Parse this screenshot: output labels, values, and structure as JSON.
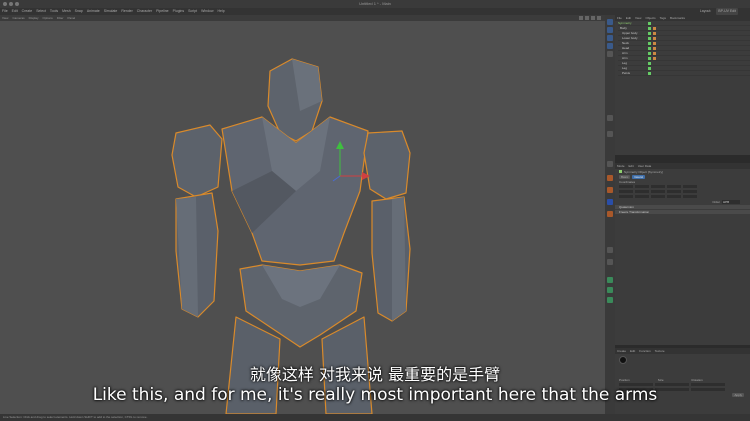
{
  "window": {
    "title": "Untitled 1 * - Main"
  },
  "menu": {
    "items": [
      "File",
      "Edit",
      "Create",
      "Select",
      "Tools",
      "Mesh",
      "Snap",
      "Animate",
      "Simulate",
      "Render",
      "Character",
      "Pipeline",
      "Plugins",
      "Script",
      "Window",
      "Help"
    ],
    "layout_label": "Layout:",
    "layout_value": "BP-UV Edit"
  },
  "viewport": {
    "menu": [
      "View",
      "Cameras",
      "Display",
      "Options",
      "Filter",
      "Panel"
    ]
  },
  "object_manager": {
    "menu": [
      "File",
      "Edit",
      "View",
      "Objects",
      "Tags",
      "Bookmarks"
    ],
    "objects": [
      "Symmetry",
      "Body",
      "Upper body",
      "Lower body",
      "Neck",
      "Head",
      "Arm",
      "Arm",
      "Leg",
      "Leg",
      "Pelvis"
    ]
  },
  "attribute_manager": {
    "menu": [
      "Mode",
      "Edit",
      "User Data"
    ],
    "object_label": "Symmetry Object [Symmetry]",
    "tabs": [
      "Basic",
      "Coord."
    ],
    "section_title": "Coordinates",
    "order_label": "Order",
    "order_value": "HPB",
    "sections": [
      "Quaternion",
      "Freeze Transformation"
    ]
  },
  "bottom_panel": {
    "tabs": [
      "Create",
      "Edit",
      "Function",
      "Texture"
    ],
    "columns": [
      "Position",
      "Size",
      "Rotation"
    ],
    "apply_label": "Apply"
  },
  "subtitles": {
    "chinese": "就像这样  对我来说  最重要的是手臂",
    "english": "Like this, and for me, it's really most important here that the arms"
  },
  "status": {
    "text": "Live Selection: Click and drag to select elements. Hold down SHIFT to add to the selection, CTRL to remove."
  },
  "colors": {
    "viewport_bg": "#4f4f4f",
    "model_fill": "#5f6570",
    "selection_outline": "#d98a2b",
    "ui_bg": "#2b2b2b",
    "accent_blue": "#3f6ea8"
  }
}
